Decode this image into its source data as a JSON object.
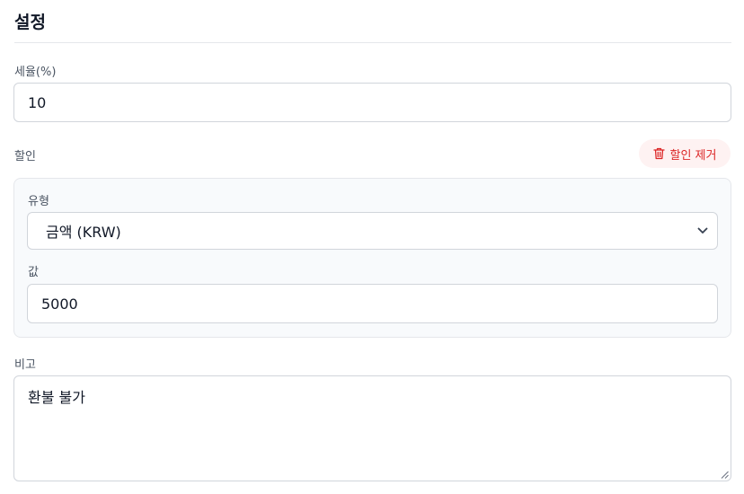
{
  "header": {
    "title": "설정"
  },
  "tax": {
    "label": "세율(%)",
    "value": "10"
  },
  "discount": {
    "label": "할인",
    "remove_label": "할인 제거",
    "type_label": "유형",
    "type_selected": "금액 (KRW)",
    "value_label": "값",
    "value": "5000"
  },
  "notes": {
    "label": "비고",
    "value": "환불 불가"
  },
  "colors": {
    "accent_danger": "#dc2626",
    "danger_bg": "#fef2f2",
    "panel_bg": "#f8fafc"
  },
  "icons": {
    "remove": "trash-icon",
    "select": "chevron-down-icon",
    "resize": "resize-handle-icon"
  }
}
